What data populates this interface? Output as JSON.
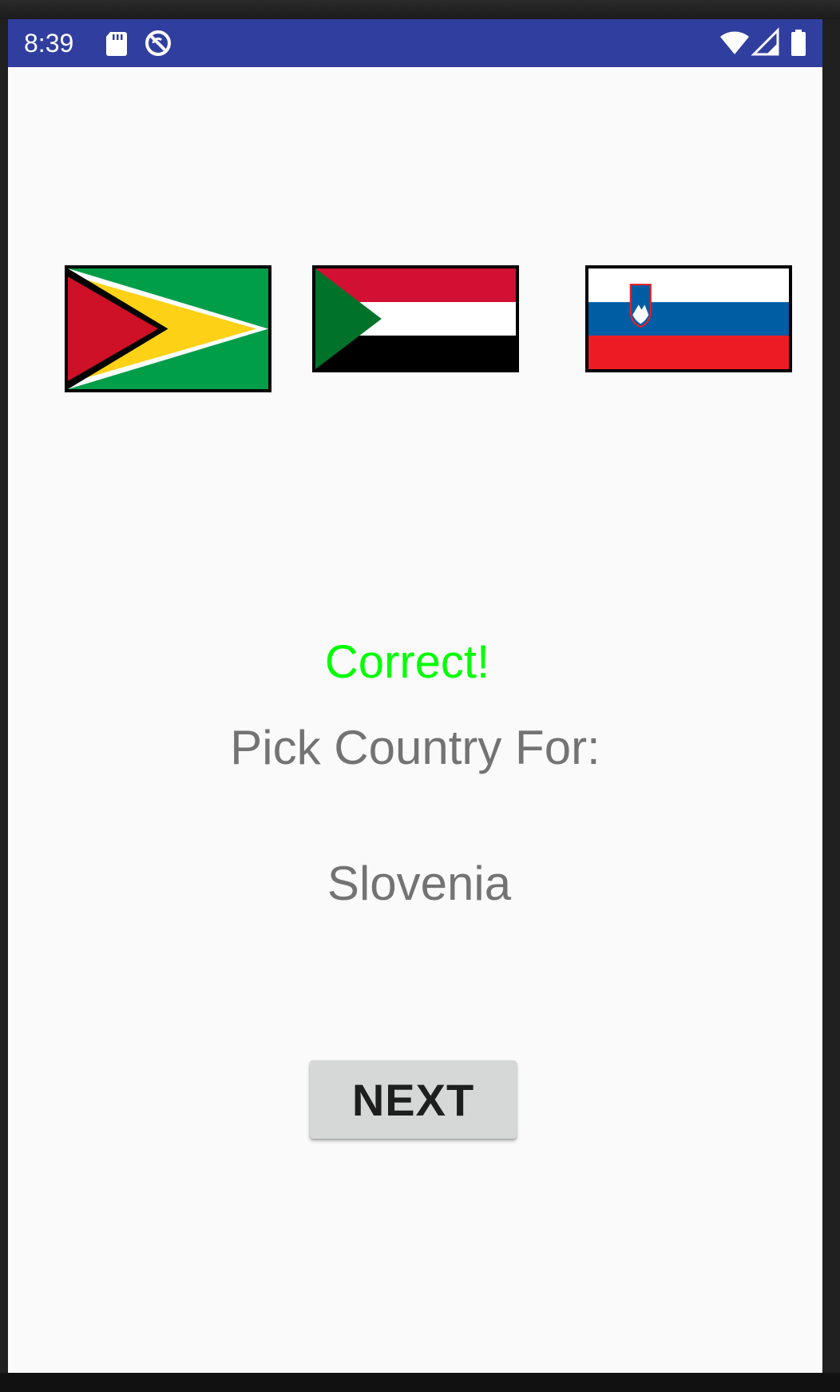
{
  "status_bar": {
    "time": "8:39",
    "left_icons": [
      "sd-card-icon",
      "sync-disabled-icon"
    ],
    "right_icons": [
      "wifi-icon",
      "cell-signal-icon",
      "battery-icon"
    ],
    "color": "#303f9f"
  },
  "flags": [
    {
      "name": "guyana-flag",
      "icon": "guyana-flag"
    },
    {
      "name": "sudan-flag",
      "icon": "sudan-flag"
    },
    {
      "name": "slovenia-flag",
      "icon": "slovenia-flag"
    }
  ],
  "quiz": {
    "result": "Correct!",
    "result_color": "#00ff00",
    "prompt": "Pick Country For:",
    "country": "Slovenia"
  },
  "actions": {
    "next_label": "NEXT"
  },
  "colors": {
    "background": "#fafafa",
    "text_gray": "#737373",
    "button_bg": "#d6d7d7"
  }
}
